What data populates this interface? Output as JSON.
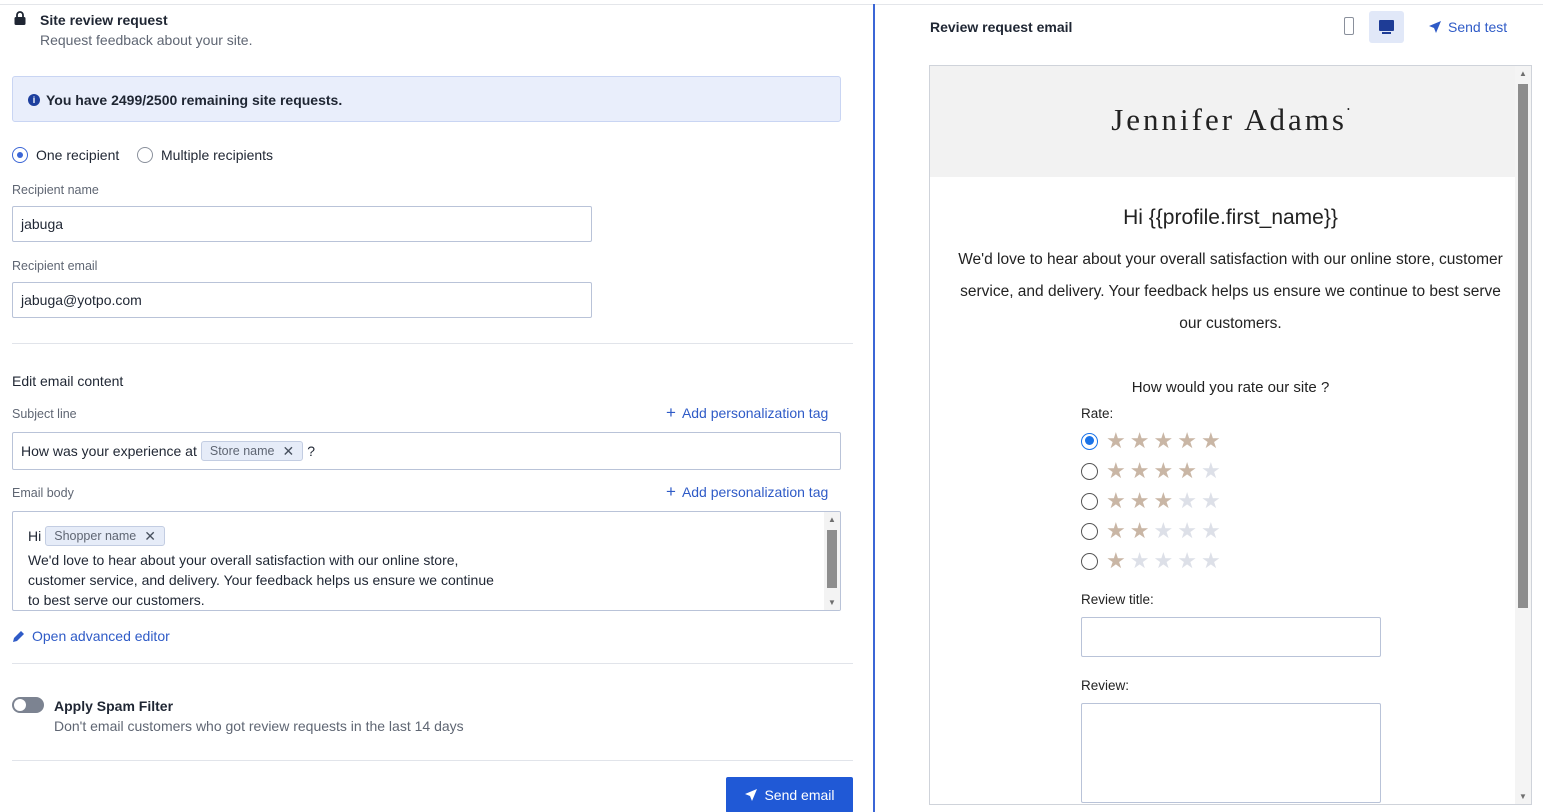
{
  "header": {
    "title": "Site review request",
    "subtitle": "Request feedback about your site."
  },
  "info_banner": {
    "text": "You have 2499/2500 remaining site requests."
  },
  "recipients": {
    "option_one": "One recipient",
    "option_multiple": "Multiple recipients",
    "selected": "One recipient"
  },
  "recipient_name": {
    "label": "Recipient name",
    "value": "jabuga"
  },
  "recipient_email": {
    "label": "Recipient email",
    "value": "jabuga@yotpo.com"
  },
  "email_content": {
    "section_title": "Edit email content",
    "subject_label": "Subject line",
    "add_tag_label": "Add personalization tag",
    "subject_prefix": "How was your experience at",
    "subject_tag": "Store name",
    "subject_suffix": "?",
    "body_label": "Email body",
    "body_greeting": "Hi",
    "body_tag": "Shopper name",
    "body_text": "We'd love to hear about your overall satisfaction with our online store,\n customer service, and delivery. Your feedback helps us ensure we continue\n to best serve our customers.",
    "advanced_editor": "Open advanced editor"
  },
  "spam_filter": {
    "title": "Apply Spam Filter",
    "description": "Don't email customers who got review requests in the last 14 days",
    "enabled": false
  },
  "send_button": "Send email",
  "preview": {
    "title": "Review request email",
    "send_test": "Send test",
    "active_view": "desktop",
    "brand": "Jennifer Adams",
    "brand_mark": "•",
    "greeting": "Hi {{profile.first_name}}",
    "text": "We'd love to hear about your overall satisfaction with our online store, customer service, and delivery. Your feedback helps us ensure we continue to best serve our customers.",
    "question": "How would you rate our site ?",
    "rate_label": "Rate:",
    "ratings": [
      5,
      4,
      3,
      2,
      1
    ],
    "max_stars": 5,
    "selected_rating": 5,
    "review_title_label": "Review title:",
    "review_label": "Review:"
  },
  "colors": {
    "accent": "#2059d6",
    "link": "#2f5bc7",
    "star_filled": "#c9b6a5",
    "star_empty": "#dde0e8"
  }
}
